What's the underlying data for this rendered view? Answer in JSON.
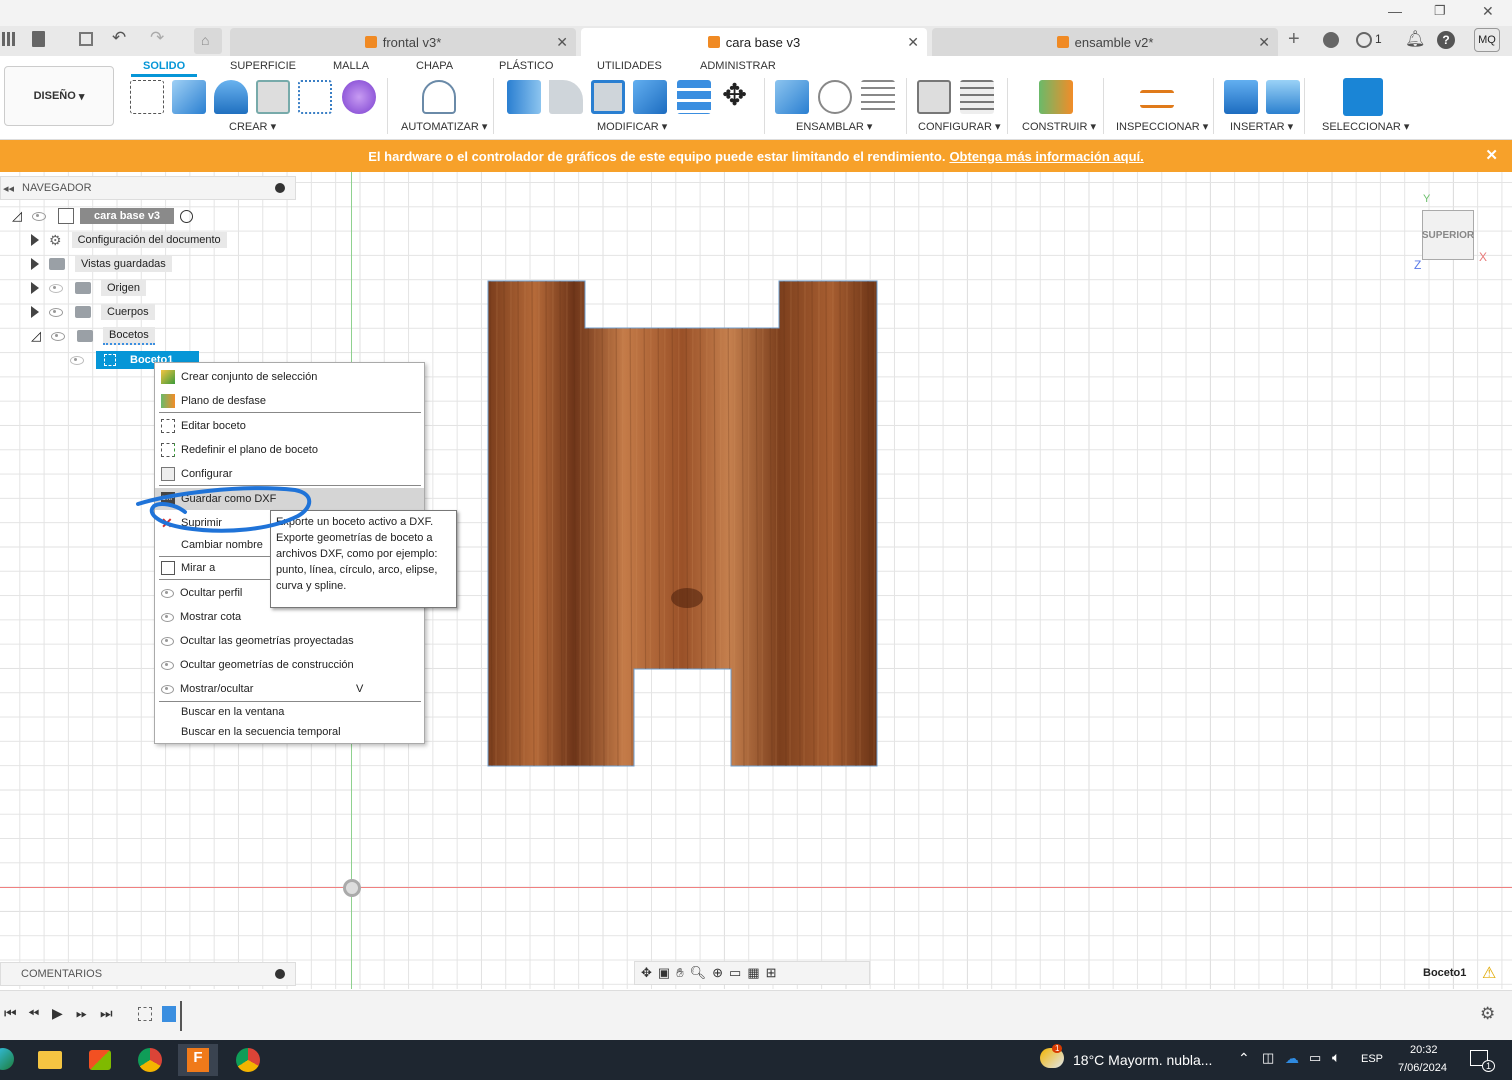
{
  "window": {
    "minimize": "—",
    "restore": "❐",
    "close": "✕"
  },
  "doc_tabs": [
    {
      "label": "frontal v3*",
      "active": false
    },
    {
      "label": "cara base v3",
      "active": true
    },
    {
      "label": "ensamble v2*",
      "active": false
    }
  ],
  "topright": {
    "jobs_count": "1",
    "user_initials": "MQ"
  },
  "workspace": {
    "label": "DISEÑO"
  },
  "ribbon_tabs": [
    "SOLIDO",
    "SUPERFICIE",
    "MALLA",
    "CHAPA",
    "PLÁSTICO",
    "UTILIDADES",
    "ADMINISTRAR"
  ],
  "ribbon_groups": [
    "CREAR",
    "AUTOMATIZAR",
    "MODIFICAR",
    "ENSAMBLAR",
    "CONFIGURAR",
    "CONSTRUIR",
    "INSPECCIONAR",
    "INSERTAR",
    "SELECCIONAR"
  ],
  "banner": {
    "text": "El hardware o el controlador de gráficos de este equipo puede estar limitando el rendimiento.",
    "link": "Obtenga más información aquí."
  },
  "navigator": {
    "title": "NAVEGADOR",
    "root": "cara base v3",
    "items": [
      "Configuración del documento",
      "Vistas guardadas",
      "Origen",
      "Cuerpos",
      "Bocetos"
    ],
    "selected": "Boceto1"
  },
  "context_menu": {
    "items": [
      "Crear conjunto de selección",
      "Plano de desfase",
      "Editar boceto",
      "Redefinir el plano de boceto",
      "Configurar",
      "Guardar como DXF",
      "Suprimir",
      "Cambiar nombre",
      "Mirar a",
      "Ocultar perfil",
      "Mostrar cota",
      "Ocultar las geometrías proyectadas",
      "Ocultar geometrías de construcción",
      "Mostrar/ocultar",
      "Buscar en la ventana",
      "Buscar en la secuencia temporal"
    ],
    "shortcut": "V"
  },
  "tooltip": {
    "lines": [
      "Exporte un boceto activo a DXF.",
      "Exporte geometrías de boceto a",
      "archivos DXF, como por ejemplo:",
      "punto, línea, círculo, arco, elipse,",
      "curva y spline."
    ]
  },
  "viewcube": {
    "face": "SUPERIOR",
    "axis_y": "Y",
    "axis_x": "X",
    "axis_z": "Z"
  },
  "comments": {
    "title": "COMENTARIOS"
  },
  "status": {
    "active_sketch": "Boceto1"
  },
  "taskbar": {
    "weather": "18°C  Mayorm. nubla...",
    "lang": "ESP",
    "time": "20:32",
    "date": "7/06/2024",
    "notif_count": "1",
    "weather_badge": "1"
  }
}
